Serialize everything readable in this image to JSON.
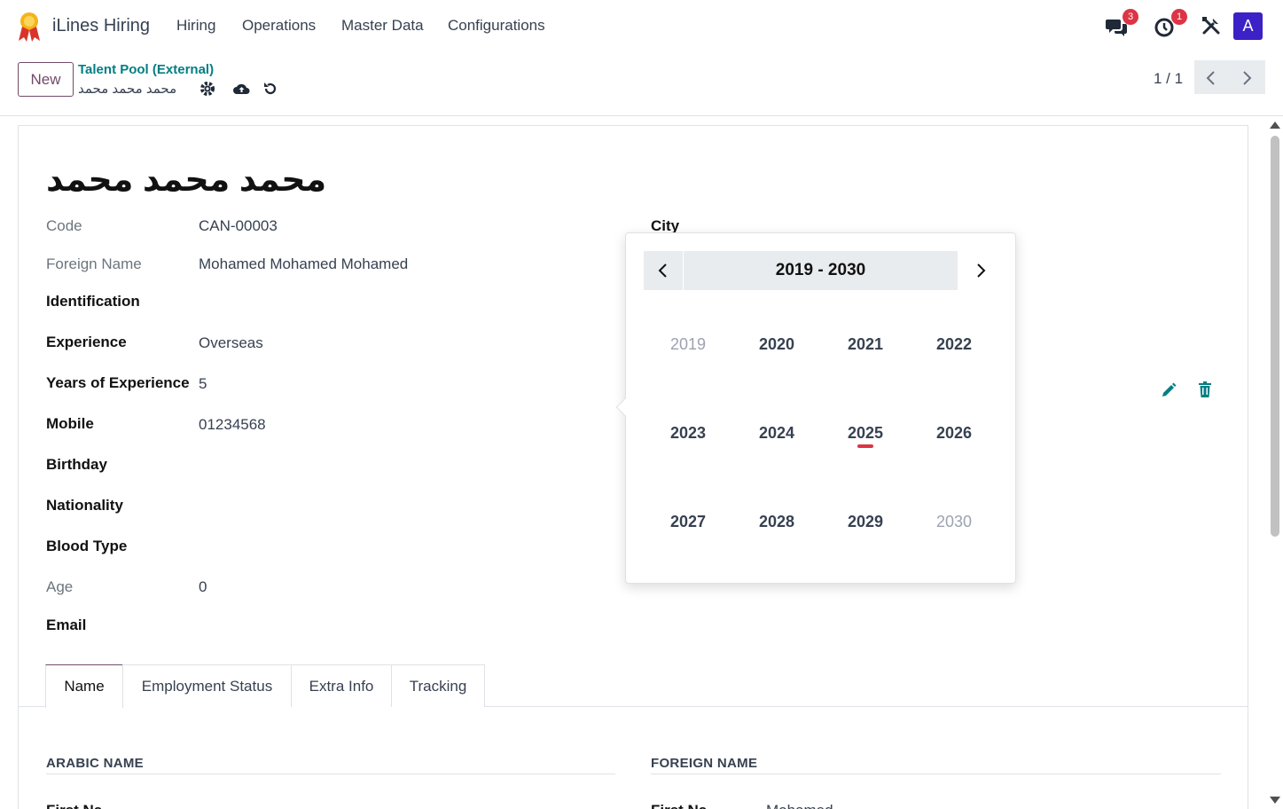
{
  "nav": {
    "app_name": "iLines Hiring",
    "menu": [
      "Hiring",
      "Operations",
      "Master Data",
      "Configurations"
    ],
    "messages_badge": "3",
    "activities_badge": "1",
    "avatar_initial": "A",
    "avatar_color": "#3b21c6"
  },
  "control_panel": {
    "new_label": "New",
    "breadcrumb_parent": "Talent Pool (External)",
    "breadcrumb_current": "محمد محمد محمد",
    "pager": "1 / 1"
  },
  "record": {
    "title": "محمد محمد محمد",
    "fields": [
      {
        "label": "Code",
        "value": "CAN-00003"
      },
      {
        "label": "Foreign Name",
        "value": "Mohamed Mohamed Mohamed"
      },
      {
        "label": "Identification",
        "value": ""
      },
      {
        "label": "Experience",
        "value": "Overseas"
      },
      {
        "label": "Years of Experience",
        "value": "5"
      },
      {
        "label": "Mobile",
        "value": "01234568"
      },
      {
        "label": "Birthday",
        "value": ""
      },
      {
        "label": "Nationality",
        "value": ""
      },
      {
        "label": "Blood Type",
        "value": ""
      },
      {
        "label": "Age",
        "value": "0"
      },
      {
        "label": "Email",
        "value": ""
      }
    ],
    "city_label": "City"
  },
  "tabs": [
    "Name",
    "Employment Status",
    "Extra Info",
    "Tracking"
  ],
  "sections": {
    "arabic_name": "ARABIC NAME",
    "foreign_name": "FOREIGN NAME",
    "arabic_first_name_label": "First Na",
    "foreign_first_name_label": "First Na",
    "foreign_first_name_value": "Mohamed"
  },
  "datepicker": {
    "range_title": "2019 - 2030",
    "years": [
      "2019",
      "2020",
      "2021",
      "2022",
      "2023",
      "2024",
      "2025",
      "2026",
      "2027",
      "2028",
      "2029",
      "2030"
    ],
    "today_year": "2025",
    "today_color": "#dc3545"
  },
  "colors": {
    "brand": "#714b67",
    "link": "#017e84"
  }
}
